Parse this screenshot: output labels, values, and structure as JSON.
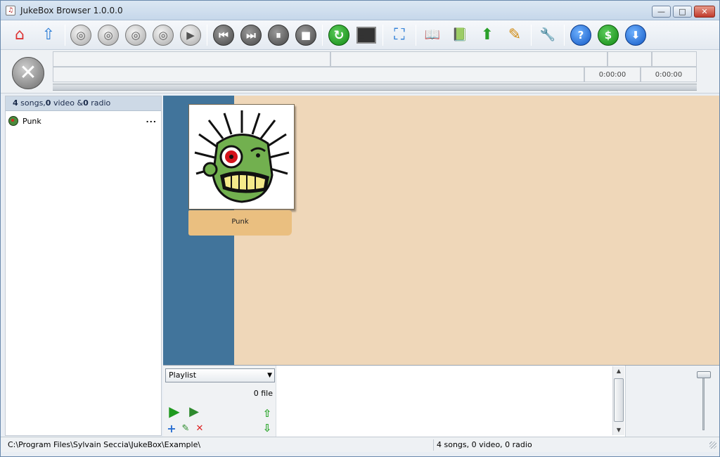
{
  "window": {
    "title": "JukeBox Browser 1.0.0.0",
    "app_icon_glyph": "♫",
    "minimize_glyph": "—",
    "maximize_glyph": "□",
    "close_glyph": "✕"
  },
  "toolbar": {
    "buttons": [
      {
        "name": "home-icon",
        "glyph": "⌂"
      },
      {
        "name": "folder-up-icon",
        "glyph": "⇧"
      },
      {
        "name": "cd-icon",
        "glyph": "◎"
      },
      {
        "name": "dvd-icon",
        "glyph": "◎"
      },
      {
        "name": "cd-folder-icon",
        "glyph": "◎"
      },
      {
        "name": "dvd-folder-icon",
        "glyph": "◎"
      },
      {
        "name": "play-icon",
        "glyph": "▶"
      },
      {
        "name": "previous-icon",
        "glyph": "⏮"
      },
      {
        "name": "next-icon",
        "glyph": "⏭"
      },
      {
        "name": "pause-icon",
        "glyph": "⏸"
      },
      {
        "name": "stop-icon",
        "glyph": "■"
      },
      {
        "name": "refresh-icon",
        "glyph": "↻"
      },
      {
        "name": "monitor-icon",
        "glyph": "▬"
      },
      {
        "name": "fullscreen-icon",
        "glyph": "⛶"
      },
      {
        "name": "book-icon",
        "glyph": "📖"
      },
      {
        "name": "book-refresh-icon",
        "glyph": "📗"
      },
      {
        "name": "book-upload-icon",
        "glyph": "⬆"
      },
      {
        "name": "pencil-icon",
        "glyph": "✎"
      },
      {
        "name": "wrench-icon",
        "glyph": "🔧"
      },
      {
        "name": "help-icon",
        "glyph": "?"
      },
      {
        "name": "donate-icon",
        "glyph": "$"
      },
      {
        "name": "download-icon",
        "glyph": "⬇"
      }
    ]
  },
  "player": {
    "stop_glyph": "✕",
    "time_elapsed": "0:00:00",
    "time_total": "0:00:00"
  },
  "library": {
    "header_songs_count": "4",
    "header_songs_label": " songs,",
    "header_video_count": "0",
    "header_video_label": " video &",
    "header_radio_count": "0",
    "header_radio_label": " radio",
    "tree": [
      {
        "label": "Punk",
        "more": "..."
      }
    ]
  },
  "albums": [
    {
      "caption": "Punk"
    }
  ],
  "playlist": {
    "selected": "Playlist",
    "dropdown_arrow": "▼",
    "file_count": "0 file",
    "play_glyph": "▶",
    "play_random_glyph": "▶",
    "add_glyph": "+",
    "edit_glyph": "✎",
    "remove_glyph": "✕",
    "move_up_glyph": "⇧",
    "move_down_glyph": "⇩",
    "scroll_up": "▲",
    "scroll_down": "▼"
  },
  "status": {
    "path": "C:\\Program Files\\Sylvain Seccia\\JukeBox\\Example\\",
    "summary": "4 songs, 0 video, 0 radio"
  }
}
